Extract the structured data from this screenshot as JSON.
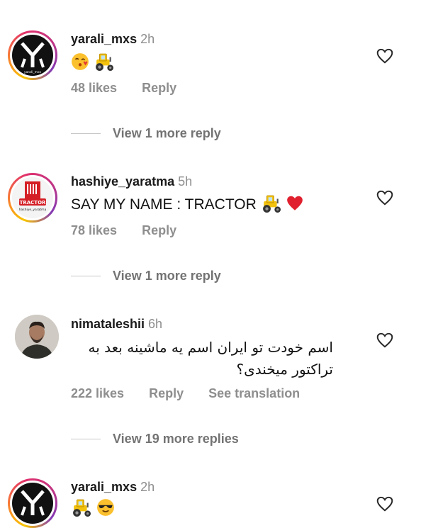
{
  "comments": [
    {
      "username": "yarali_mxs",
      "time": "2h",
      "avatar_text": "yarali_mxs",
      "emojis": [
        "kissing-face-emoji",
        "tractor-emoji"
      ],
      "likes": "48 likes",
      "reply": "Reply",
      "view_more": "View 1 more reply"
    },
    {
      "username": "hashiye_yaratma",
      "time": "5h",
      "avatar_text": "TRACTOR",
      "avatar_subtext": "hashiye_yaratma",
      "text": "SAY MY NAME : TRACTOR",
      "emojis": [
        "tractor-emoji",
        "red-heart-emoji"
      ],
      "likes": "78 likes",
      "reply": "Reply",
      "view_more": "View 1 more reply"
    },
    {
      "username": "nimataleshii",
      "time": "6h",
      "text_line1": "اسم خودت تو ایران اسم یه ماشینه بعد به",
      "text_line2": "تراکتور میخندی؟",
      "likes": "222 likes",
      "reply": "Reply",
      "see_translation": "See translation",
      "view_more": "View 19 more replies"
    },
    {
      "username": "yarali_mxs",
      "time": "2h",
      "emojis": [
        "tractor-emoji",
        "sunglasses-face-emoji"
      ]
    }
  ],
  "colors": {
    "muted": "#8e8e8e",
    "text": "#111111",
    "story_ring": [
      "#f9c600",
      "#e1306c",
      "#833ab4"
    ]
  }
}
